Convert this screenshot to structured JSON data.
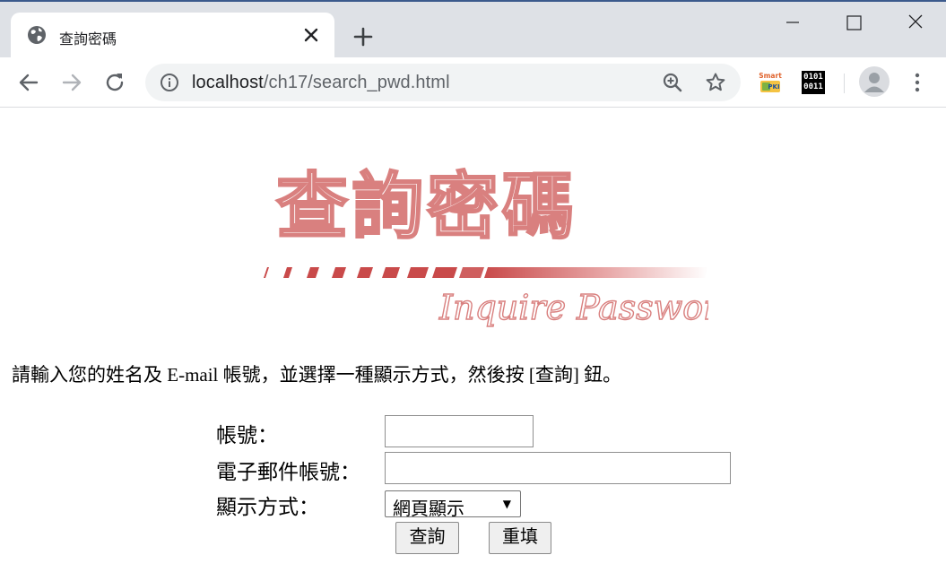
{
  "browser": {
    "tab_title": "查詢密碼",
    "url_host": "localhost",
    "url_path": "/ch17/search_pwd.html",
    "extensions": {
      "pki_line1": "Smart",
      "pki_line2": "PKI",
      "binary_line1": "0101",
      "binary_line2": "0011"
    }
  },
  "page": {
    "banner": {
      "title": "查詢密碼",
      "subtitle": "Inquire Password",
      "color": "#d9807f"
    },
    "instruction": "請輸入您的姓名及 E-mail 帳號，並選擇一種顯示方式，然後按 [查詢] 鈕。",
    "form": {
      "account_label": "帳號：",
      "account_value": "",
      "email_label": "電子郵件帳號：",
      "email_value": "",
      "display_label": "顯示方式：",
      "display_selected": "網頁顯示",
      "submit_label": "查詢",
      "reset_label": "重填"
    }
  }
}
